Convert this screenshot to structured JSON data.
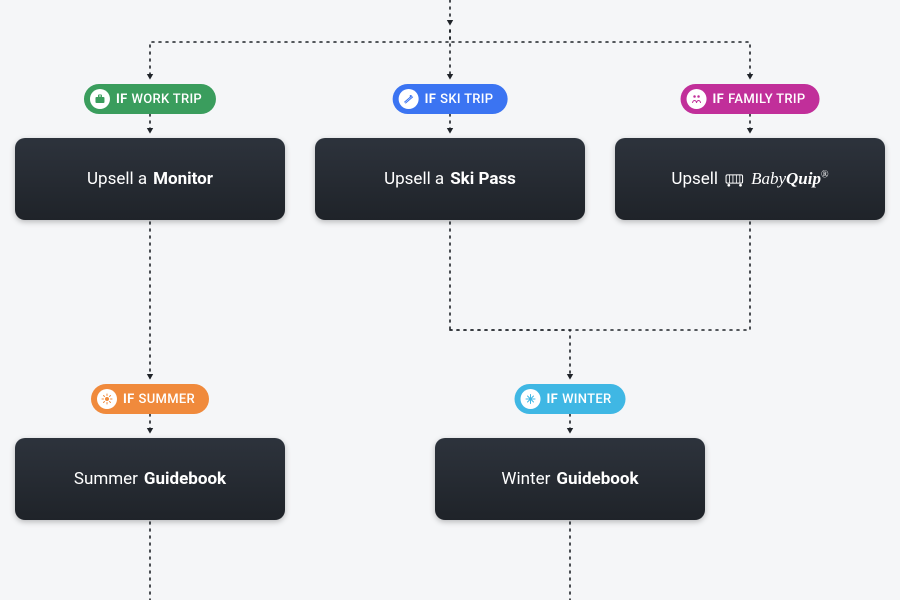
{
  "colors": {
    "work": "#3a9d5d",
    "ski": "#3b74f2",
    "family": "#c12f9a",
    "summer": "#f08a3c",
    "winter": "#3fb7e4"
  },
  "pills": {
    "work": {
      "if": "IF",
      "label": "WORK TRIP"
    },
    "ski": {
      "if": "IF",
      "label": "SKI TRIP"
    },
    "family": {
      "if": "IF",
      "label": "FAMILY TRIP"
    },
    "summer": {
      "if": "IF",
      "label": "SUMMER"
    },
    "winter": {
      "if": "IF",
      "label": "WINTER"
    }
  },
  "cards": {
    "work": {
      "prefix": "Upsell a",
      "bold": "Monitor"
    },
    "ski": {
      "prefix": "Upsell a",
      "bold": "Ski Pass"
    },
    "family": {
      "prefix": "Upsell",
      "brand1": "Baby",
      "brand2": "Quip",
      "suffix": "®"
    },
    "summer": {
      "prefix": "Summer",
      "bold": "Guidebook"
    },
    "winter": {
      "prefix": "Winter",
      "bold": "Guidebook"
    }
  }
}
